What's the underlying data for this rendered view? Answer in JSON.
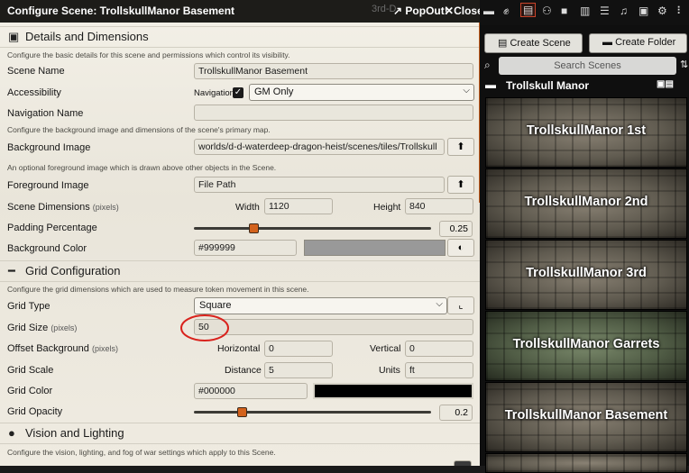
{
  "window": {
    "title": "Configure Scene: TrollskullManor Basement",
    "behind_text": "3rd-D",
    "popout_label": "PopOut!",
    "close_label": "Close"
  },
  "details": {
    "heading": "Details and Dimensions",
    "hint": "Configure the basic details for this scene and permissions which control its visibility.",
    "scene_name_label": "Scene Name",
    "scene_name_value": "TrollskullManor Basement",
    "accessibility_label": "Accessibility",
    "navigation_label": "Navigation",
    "navigation_checked": true,
    "accessibility_value": "GM Only",
    "nav_name_label": "Navigation Name",
    "nav_name_value": "",
    "bg_hint": "Configure the background image and dimensions of the scene's primary map.",
    "bg_image_label": "Background Image",
    "bg_image_value": "worlds/d-d-waterdeep-dragon-heist/scenes/tiles/Trollskull",
    "fg_hint": "An optional foreground image which is drawn above other objects in the Scene.",
    "fg_image_label": "Foreground Image",
    "fg_image_placeholder": "File Path",
    "dimensions_label": "Scene Dimensions",
    "dimensions_unit": "(pixels)",
    "width_label": "Width",
    "width_value": "1120",
    "height_label": "Height",
    "height_value": "840",
    "padding_label": "Padding Percentage",
    "padding_value": "0.25",
    "padding_fraction": 0.25,
    "bg_color_label": "Background Color",
    "bg_color_value": "#999999",
    "bg_color_swatch": "#999999"
  },
  "grid": {
    "heading": "Grid Configuration",
    "hint": "Configure the grid dimensions which are used to measure token movement in this scene.",
    "type_label": "Grid Type",
    "type_value": "Square",
    "size_label": "Grid Size",
    "size_unit": "(pixels)",
    "size_value": "50",
    "offset_label": "Offset Background",
    "offset_unit": "(pixels)",
    "horizontal_label": "Horizontal",
    "horizontal_value": "0",
    "vertical_label": "Vertical",
    "vertical_value": "0",
    "scale_label": "Grid Scale",
    "distance_label": "Distance",
    "distance_value": "5",
    "units_label": "Units",
    "units_value": "ft",
    "color_label": "Grid Color",
    "color_value": "#000000",
    "color_swatch": "#000000",
    "opacity_label": "Grid Opacity",
    "opacity_value": "0.2",
    "opacity_fraction": 0.2
  },
  "vision": {
    "heading": "Vision and Lighting",
    "hint": "Configure the vision, lighting, and fog of war settings which apply to this Scene."
  },
  "sidebar": {
    "tabs": [
      "chat",
      "combat",
      "scenes",
      "actors",
      "items",
      "journal",
      "tables",
      "playlists",
      "compendium",
      "settings"
    ],
    "create_scene_label": "Create Scene",
    "create_folder_label": "Create Folder",
    "search_placeholder": "Search Scenes",
    "folder_name": "Trollskull Manor",
    "scenes": [
      {
        "name": "TrollskullManor 1st"
      },
      {
        "name": "TrollskullManor 2nd"
      },
      {
        "name": "TrollskullManor 3rd"
      },
      {
        "name": "TrollskullManor Garrets"
      },
      {
        "name": "TrollskullManor Basement"
      }
    ]
  },
  "colors": {
    "accent": "#d3621c",
    "annotation_circle": "#d9231d"
  }
}
